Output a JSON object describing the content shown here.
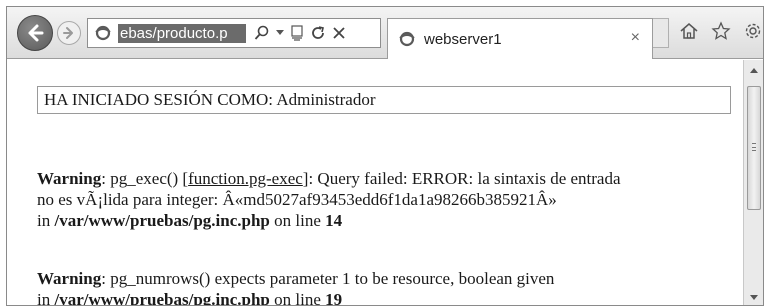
{
  "browser": {
    "address_url": "ebas/producto.p",
    "tab_title": "webserver1",
    "tab_close": "×"
  },
  "page": {
    "login_text": "HA INICIADO SESIÓN COMO: Administrador",
    "warning1": {
      "label": "Warning",
      "pre": ": pg_exec() [",
      "link": "function.pg-exec",
      "post": "]: Query failed: ERROR: la sintaxis de entrada",
      "line2": "no es vÃ¡lida para integer: Â«md5027af93453edd6f1da1a98266b385921Â»",
      "in_text": "in ",
      "path": "/var/www/pruebas/pg.inc.php",
      "on_line": " on line ",
      "line_no": "14"
    },
    "warning2": {
      "label": "Warning",
      "msg": ": pg_numrows() expects parameter 1 to be resource, boolean given",
      "in_text": "in ",
      "path": "/var/www/pruebas/pg.inc.php",
      "on_line": " on line ",
      "line_no": "19"
    }
  },
  "icons": [
    "back-arrow-icon",
    "forward-arrow-icon",
    "ie-page-icon",
    "search-icon",
    "dropdown-icon",
    "compat-view-icon",
    "refresh-icon",
    "stop-icon",
    "home-icon",
    "favorites-star-icon",
    "settings-gear-icon"
  ]
}
